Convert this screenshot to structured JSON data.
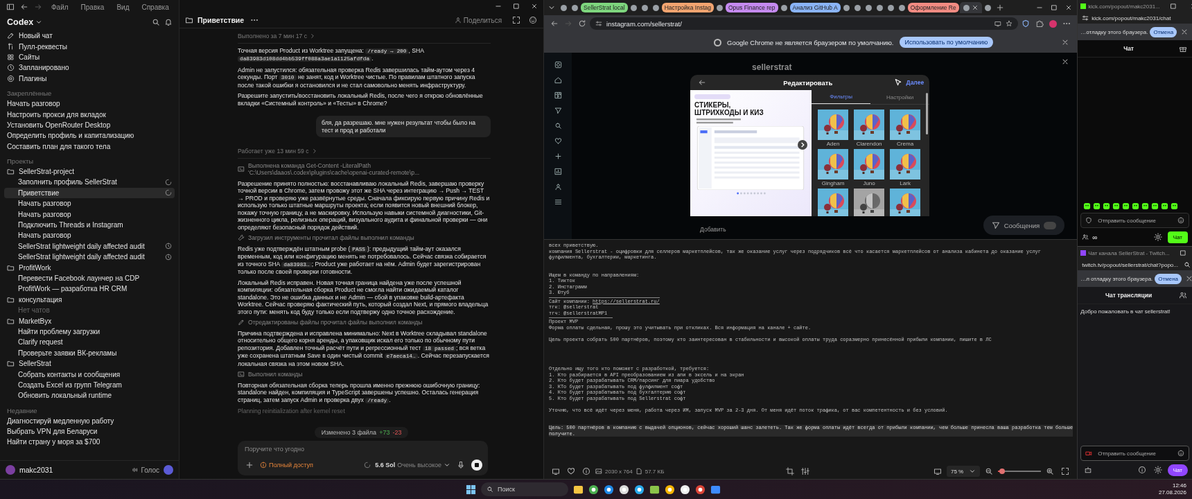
{
  "codex": {
    "menu": [
      "Файл",
      "Правка",
      "Вид",
      "Справка"
    ],
    "app_name": "Codex",
    "nav": [
      {
        "label": "Новый чат",
        "kind": "new"
      },
      {
        "label": "Пулл-реквесты",
        "kind": "pr"
      },
      {
        "label": "Сайты",
        "kind": "sites"
      },
      {
        "label": "Запланировано",
        "kind": "scheduled"
      },
      {
        "label": "Плагины",
        "kind": "plugins"
      }
    ],
    "pinned_heading": "Закреплённые",
    "pinned": [
      "Начать разговор",
      "Настроить прокси для вкладок",
      "Установить OpenRouter Desktop",
      "Определить профиль и капитализацию",
      "Составить план для такого тела"
    ],
    "projects_heading": "Проекты",
    "projects": [
      {
        "name": "SellerStrat-project",
        "children": [
          {
            "label": "Заполнить профиль SellerStrat",
            "selected": false,
            "kind": "running"
          },
          {
            "label": "Приветствие",
            "selected": true,
            "kind": "running"
          },
          {
            "label": "Начать разговор",
            "selected": false
          },
          {
            "label": "Начать разговор",
            "selected": false
          },
          {
            "label": "Подключить Threads и Instagram",
            "selected": false
          },
          {
            "label": "Начать разговор",
            "selected": false
          },
          {
            "label": "SellerStrat lightweight daily affected audit",
            "selected": false,
            "kind": "scheduled"
          },
          {
            "label": "SellerStrat lightweight daily affected audit",
            "selected": false,
            "kind": "scheduled"
          }
        ]
      },
      {
        "name": "ProfitWork",
        "children": [
          {
            "label": "Перевести Facebook лаунчер на CDP",
            "selected": false
          },
          {
            "label": "ProfitWork — разработка HR CRM",
            "selected": false
          }
        ]
      },
      {
        "name": "консультация",
        "empty_text": "Нет чатов"
      },
      {
        "name": "MarketByx",
        "children": [
          {
            "label": "Найти проблему загрузки",
            "selected": false
          },
          {
            "label": "Clarify request",
            "selected": false
          },
          {
            "label": "Проверьте заявки ВК-рекламы",
            "selected": false
          }
        ]
      },
      {
        "name": "SellerStrat",
        "children": [
          {
            "label": "Собрать контакты и сообщения",
            "selected": false
          },
          {
            "label": "Создать Excel из групп Telegram",
            "selected": false
          },
          {
            "label": "Обновить локальный runtime",
            "selected": false
          }
        ]
      }
    ],
    "recent_heading": "Недавние",
    "recent": [
      "Диагностируй медленную работу",
      "Выбрать VPN для Беларуси",
      "Найти страну у моря за $700"
    ],
    "user": "makc2031",
    "voice_button": "Голос",
    "thread_title": "Приветствие",
    "share_button": "Поделиться",
    "messages": [
      {
        "kind": "meta",
        "text": "Выполнено за 7 мин 17 с"
      },
      {
        "kind": "text",
        "parts": [
          {
            "text": "Точная версия Product из Worktree запущена: ",
            "code": false
          },
          {
            "text": "/ready → 200",
            "code": true
          },
          {
            "text": ", SHA ",
            "code": false
          },
          {
            "text": "da83983d108dd4bb539ff088a3ae1a1125afdfda",
            "code": true
          },
          {
            "text": ".",
            "code": false
          }
        ]
      },
      {
        "kind": "text",
        "parts": [
          {
            "text": "Admin не запустился: обязательная проверка Redis завершилась тайм-аутом через 4 секунды. Порт ",
            "code": false
          },
          {
            "text": "3010",
            "code": true
          },
          {
            "text": " не занят, код и Worktree чистые. По правилам штатного запуска после такой ошибки я остановился и не стал самовольно менять инфраструктуру.",
            "code": false
          }
        ]
      },
      {
        "kind": "text",
        "parts": [
          {
            "text": "Разрешите запустить/восстановить локальный Redis, после чего я открою обновлённые вкладки «Системный контроль» и «Тесты» в Chrome?",
            "code": false
          }
        ]
      },
      {
        "kind": "user",
        "text": "бля, да разрешаю. мне нужен результат чтобы было на тест и прод и работали"
      },
      {
        "kind": "meta",
        "text": "Работает уже 13 мин 59 с"
      },
      {
        "kind": "command",
        "text": "Выполнена команда Get-Content -LiteralPath 'C:\\Users\\daaos\\.codex\\plugins\\cache\\openai-curated-remote\\p..."
      },
      {
        "kind": "text",
        "parts": [
          {
            "text": "Разрешение принято полностью: восстанавливаю локальный Redis, завершаю проверку точной версии в Chrome, затем провожу этот же SHA через интеграцию → Push → TEST → PROD и проверяю уже развёрнутые среды. Сначала фиксирую первую причину Redis и использую только штатные маршруты проекта; если появится новый внешний блокер, покажу точную границу, а не маскировку. Использую навыки системной диагностики, Git-жизненного цикла, релизных операций, визуального аудита и финальной проверки — они определяют безопасный порядок действий.",
            "code": false
          }
        ]
      },
      {
        "kind": "tools",
        "text": "Загрузил инструменты прочитал файлы выполнил команды"
      },
      {
        "kind": "text",
        "parts": [
          {
            "text": "Redis уже подтверждён штатным probe (",
            "code": false
          },
          {
            "text": "PASS",
            "code": true
          },
          {
            "text": "): предыдущий тайм-аут оказался временным, код или конфигурацию менять не потребовалось. Сейчас связка собирается из точного SHA ",
            "code": false
          },
          {
            "text": "da83983…",
            "code": true
          },
          {
            "text": "; Product уже работает на нём. Admin будет зарегистрирован только после своей проверки готовности.",
            "code": false
          }
        ]
      },
      {
        "kind": "text",
        "parts": [
          {
            "text": "Локальный Redis исправен. Новая точная граница найдена уже после успешной компиляции: обязательная сборка Product не смогла найти ожидаемый каталог standalone. Это не ошибка данных и не Admin — сбой в упаковке build-артефакта Worktree. Сейчас проверяю фактический путь, который создал Next, и прямого владельца этого пути: менять код буду только если подтвержу одно точное расхождение.",
            "code": false
          }
        ]
      },
      {
        "kind": "edit",
        "text": "Отредактированы файлы прочитал файлы выполнил команды"
      },
      {
        "kind": "text",
        "parts": [
          {
            "text": "Причина подтверждена и исправлена минимально: Next в Worktree складывал standalone относительно общего корня аренды, а упаковщик искал его только по обычному пути репозитория. Добавлен точный расчёт пути и регрессионный тест ",
            "code": false
          },
          {
            "text": "18 passed",
            "code": true
          },
          {
            "text": "; вся ветка уже сохранена штатным Save в один чистый commit ",
            "code": false
          },
          {
            "text": "e7aeca14…",
            "code": true
          },
          {
            "text": ". Сейчас перезапускается локальная связка на этом новом SHA.",
            "code": false
          }
        ]
      },
      {
        "kind": "command",
        "text": "Выполнил команды"
      },
      {
        "kind": "text",
        "parts": [
          {
            "text": "Повторная обязательная сборка теперь прошла именно прежнюю ошибочную границу: standalone найден, компиляция и TypeScript завершены успешно. Осталась генерация страниц, затем запуск Admin и проверка двух ",
            "code": false
          },
          {
            "text": "/ready",
            "code": true
          },
          {
            "text": ".",
            "code": false
          }
        ]
      },
      {
        "kind": "status",
        "text": "Planning reinitialization after kernel reset"
      }
    ],
    "changes": {
      "label": "Изменено 3 файла",
      "added": "+73",
      "removed": "-23"
    },
    "composer": {
      "placeholder": "Поручите что угодно",
      "access": "Полный доступ",
      "model": "5.6 Sol",
      "effort": "Очень высокое"
    }
  },
  "browser": {
    "tabs": [
      {
        "kind": "tab",
        "selected": false
      },
      {
        "kind": "tab",
        "selected": false
      },
      {
        "kind": "group",
        "label": "SellerStrat local",
        "color": "#7ed67e"
      },
      {
        "kind": "tab",
        "selected": false
      },
      {
        "kind": "tab",
        "selected": false
      },
      {
        "kind": "tab",
        "selected": false
      },
      {
        "kind": "group",
        "label": "Настройка Instag",
        "color": "#f2a470"
      },
      {
        "kind": "tab",
        "selected": false
      },
      {
        "kind": "group",
        "label": "Opus Finance rep",
        "color": "#c58af0"
      },
      {
        "kind": "tab",
        "selected": false
      },
      {
        "kind": "group",
        "label": "Анализ GitHub A",
        "color": "#8ab4f8"
      },
      {
        "kind": "tab",
        "selected": false
      },
      {
        "kind": "tab",
        "selected": false
      },
      {
        "kind": "tab",
        "selected": false
      },
      {
        "kind": "tab",
        "selected": false
      },
      {
        "kind": "tab",
        "selected": false
      },
      {
        "kind": "tab",
        "selected": false
      },
      {
        "kind": "group",
        "label": "Оформление Re",
        "color": "#f28b82"
      },
      {
        "kind": "tab",
        "selected": true
      },
      {
        "kind": "tab",
        "selected": false
      }
    ],
    "url": "instagram.com/sellerstrat/",
    "infobar": {
      "text": "Google Chrome не является браузером по умолчанию.",
      "button": "Использовать по умолчанию"
    },
    "instagram": {
      "profile_name": "sellerstrat",
      "add_label": "Добавить",
      "messages_label": "Сообщения",
      "modal": {
        "title": "Редактировать",
        "next": "Далее",
        "post_headline": "СТИКЕРЫ,\nШТРИХКОДЫ И КИЗ",
        "tabs": [
          {
            "label": "Фильтры",
            "selected": true
          },
          {
            "label": "Настройки",
            "selected": false
          }
        ],
        "filters": [
          {
            "name": "Aden",
            "grayscale": false
          },
          {
            "name": "Clarendon",
            "grayscale": false
          },
          {
            "name": "Crema",
            "grayscale": false
          },
          {
            "name": "Gingham",
            "grayscale": false
          },
          {
            "name": "Juno",
            "grayscale": false
          },
          {
            "name": "Lark",
            "grayscale": false
          },
          {
            "grayscale": false
          },
          {
            "grayscale": true
          },
          {
            "grayscale": false
          }
        ]
      }
    }
  },
  "viewer": {
    "lines": [
      {
        "kind": "text",
        "text": "всех приветствую."
      },
      {
        "kind": "text",
        "text": "компания Sellerstrat - оцифровки для селлеров маркетплейсов, так же оказание услуг через подрядчиков всё что касается маркетплейсов от анализа кабинета до оказание услуг фулфилмента, бухгалтерии, маркетинга."
      },
      {
        "kind": "blank"
      },
      {
        "kind": "blank"
      },
      {
        "kind": "text",
        "text": "Ищем в команду по направлениям:"
      },
      {
        "kind": "text",
        "text": "1. Тикток"
      },
      {
        "kind": "text",
        "text": "2. Инстаграмм"
      },
      {
        "kind": "text",
        "text": "3. Ютуб"
      },
      {
        "kind": "rule",
        "short": false
      },
      {
        "kind": "link",
        "text": "Сайт компании: ",
        "link": "https://sellerstrat.ru/"
      },
      {
        "kind": "text",
        "text": "тгк: @sellerstrat"
      },
      {
        "kind": "text",
        "text": "тгч: @sellerstratMP1"
      },
      {
        "kind": "rule",
        "short": true
      },
      {
        "kind": "text",
        "text": "Проект MVP"
      },
      {
        "kind": "text",
        "text": "Форма оплаты сдельная, прошу это учитывать при откликах. Вся информация на канале + сайте."
      },
      {
        "kind": "blank"
      },
      {
        "kind": "text",
        "text": "Цель проекта собрать 500 партнёров, поэтому кто заинтересован в стабильности и высокой оплаты труда соразмерно принесённой прибыли компании, пишите в ЛС"
      },
      {
        "kind": "blank"
      },
      {
        "kind": "blank"
      },
      {
        "kind": "blank"
      },
      {
        "kind": "blank"
      },
      {
        "kind": "text",
        "text": "Отдельно ищу того кто поможет с разработкой, требуется:"
      },
      {
        "kind": "text",
        "text": "1. Кто разбирается в API преобразованием из апи в эксель и на экран"
      },
      {
        "kind": "text",
        "text": "2. Кто будет разрабатывать CRM/парсинг для пиара удобство"
      },
      {
        "kind": "text",
        "text": "3. КТо будет разрабатывать под фулфилмент софт"
      },
      {
        "kind": "text",
        "text": "4. Кто будет разрабатывать под бухгалтерию софт"
      },
      {
        "kind": "text",
        "text": "5. Кто будет разрабатывать под Sellerstrat софт"
      },
      {
        "kind": "blank"
      },
      {
        "kind": "text",
        "text": "Уточню, что всё идёт через меня, работа через ИМ, запуск MVP за 2-3 дня. От меня идёт поток трафика, от вас компетентность и без условий."
      },
      {
        "kind": "blank"
      },
      {
        "kind": "blank"
      },
      {
        "kind": "highlight",
        "text": "Цель: 500 партнёров в компанию с выдачей опционов, сейчас хороший шанс залететь. Так же форма оплаты идёт всегда от прибыли компании, чем больше принесла ваша разработка тем больше получите."
      }
    ],
    "dimensions": "2030 x 764",
    "filesize": "57.7 КБ",
    "zoom": "75 %",
    "zoom_slider": {
      "level": 0.1
    }
  },
  "kick": {
    "title": "kick.com/popout/makc2031...",
    "url": "kick.com/popout/makc2031/chat",
    "infobar_text": "…отладку этого браузера.",
    "cancel": "Отмена",
    "heading": "Чат",
    "input_placeholder": "Отправить сообщение",
    "counter": "∞",
    "send": "Чат"
  },
  "twitch": {
    "title": "Чат канала SellerStrat - Twitch...",
    "url": "twitch.tv/popout/sellerstrat/chat?popo...",
    "infobar_text": "…л отладку этого браузера.",
    "cancel": "Отмена",
    "heading": "Чат трансляции",
    "welcome": "Добро пожаловать в чат sellerstrat!",
    "input_placeholder": "Отправить сообщение",
    "send": "Чат"
  },
  "taskbar": {
    "search_placeholder": "Поиск",
    "time": "12:46",
    "date": "27.08.2026"
  }
}
